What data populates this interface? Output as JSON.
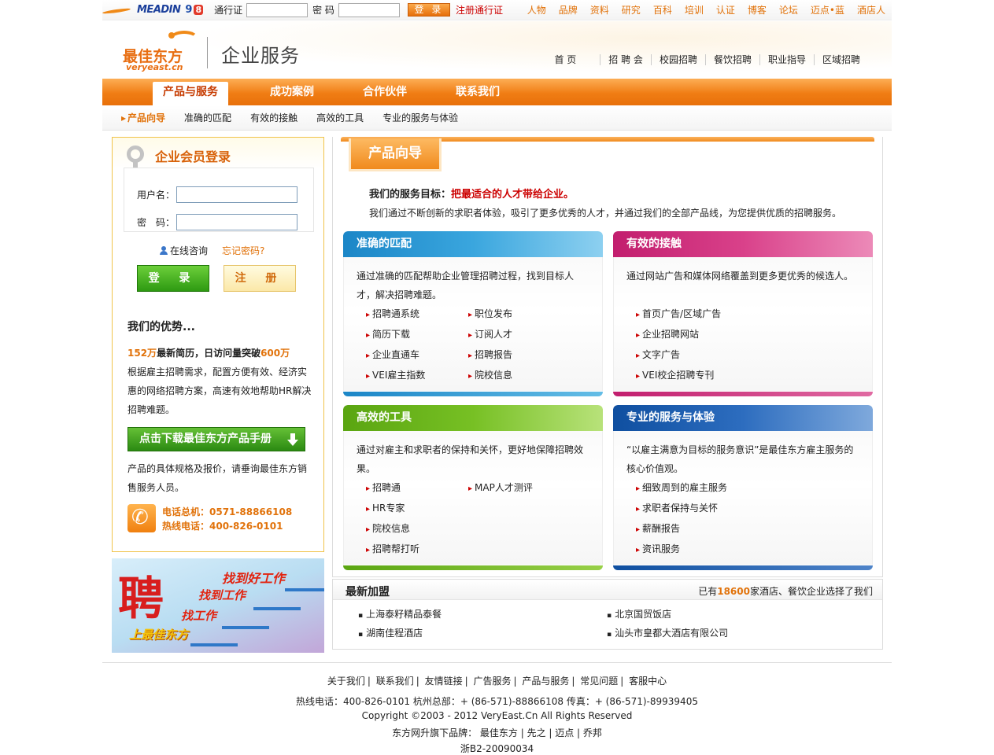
{
  "topbar": {
    "logo_meadin": "MEADIN",
    "logo_9": "9",
    "logo_8": "8",
    "passport_label": "通行证",
    "password_label": "密 码",
    "login_button": "登 录",
    "register_link": "注册通行证",
    "links": [
      "人物",
      "品牌",
      "资料",
      "研究",
      "百科",
      "培训",
      "认证",
      "博客",
      "论坛",
      "迈点•蓝",
      "酒店人"
    ]
  },
  "header": {
    "brand_cn": "最佳东方",
    "brand_en": "veryeast.cn",
    "section_title": "企业服务",
    "nav": [
      "首 页",
      "招 聘 会",
      "校园招聘",
      "餐饮招聘",
      "职业指导",
      "区域招聘"
    ]
  },
  "main_nav": {
    "tabs": [
      "产品与服务",
      "成功案例",
      "合作伙伴",
      "联系我们"
    ]
  },
  "sub_nav": {
    "items": [
      "产品向导",
      "准确的匹配",
      "有效的接触",
      "高效的工具",
      "专业的服务与体验"
    ]
  },
  "login_panel": {
    "title": "企业会员登录",
    "username_label": "用户名：",
    "password_label": "密　码：",
    "online_consult": "在线咨询",
    "forgot_password": "忘记密码?",
    "login_button": "登 录",
    "register_button": "注 册",
    "advantage_title": "我们的优势...",
    "adv_num1": "152万",
    "adv_mid": "最新简历，日访问量突破",
    "adv_num2": "600万",
    "adv_body": "根据雇主招聘需求，配置方便有效、经济实惠的网络招聘方案，高速有效地帮助HR解决招聘难题。",
    "download_button": "点击下载最佳东方产品手册",
    "spec_text": "产品的具体规格及报价，请垂询最佳东方销售服务人员。",
    "phone_main": "电话总机：0571-88866108",
    "phone_hotline": "热线电话：400-826-0101"
  },
  "banner": {
    "char": "聘",
    "line1": "找到好工作",
    "line2": "找到工作",
    "line3": "找工作",
    "line4": "上最佳东方"
  },
  "content": {
    "tab_title": "产品向导",
    "goal_prefix": "我们的服务目标：",
    "goal_highlight": "把最适合的人才带给企业。",
    "intro": "我们通过不断创新的求职者体验，吸引了更多优秀的人才，并通过我们的全部产品线，为您提供优质的招聘服务。",
    "cards": [
      {
        "title": "准确的匹配",
        "desc": "通过准确的匹配帮助企业管理招聘过程，找到目标人才，解决招聘难题。",
        "items": [
          "招聘通系统",
          "职位发布",
          "简历下载",
          "订阅人才",
          "企业直通车",
          "招聘报告",
          "VEI雇主指数",
          "院校信息"
        ]
      },
      {
        "title": "有效的接触",
        "desc": "通过网站广告和媒体网络覆盖到更多更优秀的候选人。",
        "items": [
          "首页广告/区域广告",
          "企业招聘网站",
          "文字广告",
          "VEI校企招聘专刊"
        ]
      },
      {
        "title": "高效的工具",
        "desc": "通过对雇主和求职者的保持和关怀，更好地保障招聘效果。",
        "items": [
          "招聘通",
          "MAP人才测评",
          "HR专家",
          "院校信息",
          "招聘帮打听"
        ]
      },
      {
        "title": "专业的服务与体验",
        "desc": "“以雇主满意为目标的服务意识”是最佳东方雇主服务的核心价值观。",
        "items": [
          "细致周到的雇主服务",
          "求职者保持与关怀",
          "薪酬报告",
          "资讯服务"
        ]
      }
    ]
  },
  "recent": {
    "title": "最新加盟",
    "count_prefix": "已有",
    "count": "18600",
    "count_suffix": "家酒店、餐饮企业选择了我们",
    "items": [
      "上海泰籽精品泰餐",
      "北京国贸饭店",
      "湖南佳程酒店",
      "汕头市皇都大酒店有限公司"
    ]
  },
  "footer": {
    "links": [
      "关于我们",
      "联系我们",
      "友情链接",
      "广告服务",
      "产品与服务",
      "常见问题",
      "客服中心"
    ],
    "contact": "热线电话：400-826-0101 杭州总部：+ (86-571)-88866108 传真：+ (86-571)-89939405",
    "copyright": "Copyright ©2003 - 2012 VeryEast.Cn All Rights Reserved",
    "brands": "东方网升旗下品牌： 最佳东方 | 先之 | 迈点 | 乔邦",
    "icp": "浙B2-20090034"
  },
  "colors": {
    "accent_orange": "#f08a1d",
    "highlight_red": "#cc0000",
    "card_blue": "#1b86c7",
    "card_pink": "#c21e6e",
    "card_green": "#5aa511",
    "card_navy": "#0f4fa0"
  }
}
